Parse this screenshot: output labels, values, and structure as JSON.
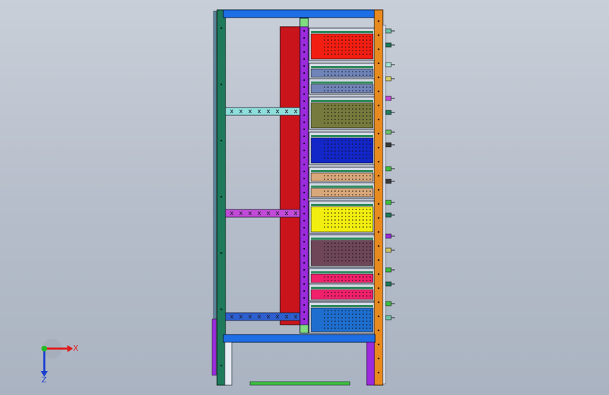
{
  "viewport": {
    "background": "#b9c0cc"
  },
  "model": {
    "colors": {
      "frame_green": "#1e7a5a",
      "frame_blue": "#1e6ee6",
      "rail_orange": "#e88a1e",
      "rail_purple": "#9b2bdc",
      "panel_red": "#c8141a",
      "crossbar_cyan": "#8fe0dc",
      "crossbar_magenta": "#c24ad8",
      "crossbar_blue": "#2d5fd0",
      "base_green": "#3fbf3f"
    },
    "modules": [
      {
        "name": "module-red",
        "color": "#f21e12"
      },
      {
        "name": "module-slate-1",
        "color": "#6f84b8"
      },
      {
        "name": "module-slate-2",
        "color": "#7184b8"
      },
      {
        "name": "module-olive",
        "color": "#767a3c"
      },
      {
        "name": "module-navy",
        "color": "#1326c8"
      },
      {
        "name": "module-tan-1",
        "color": "#d9a87a"
      },
      {
        "name": "module-tan-2",
        "color": "#d9a87a"
      },
      {
        "name": "module-yellow",
        "color": "#f2ee10"
      },
      {
        "name": "module-plum",
        "color": "#6e4658"
      },
      {
        "name": "module-pink-1",
        "color": "#f0206a"
      },
      {
        "name": "module-pink-2",
        "color": "#f0206a"
      },
      {
        "name": "module-blue",
        "color": "#1e6ecf"
      }
    ]
  },
  "triad": {
    "x_label": "X",
    "z_label": "Z",
    "x_color": "#e01a1a",
    "y_color": "#22bb22",
    "z_color": "#1a3fd0"
  }
}
